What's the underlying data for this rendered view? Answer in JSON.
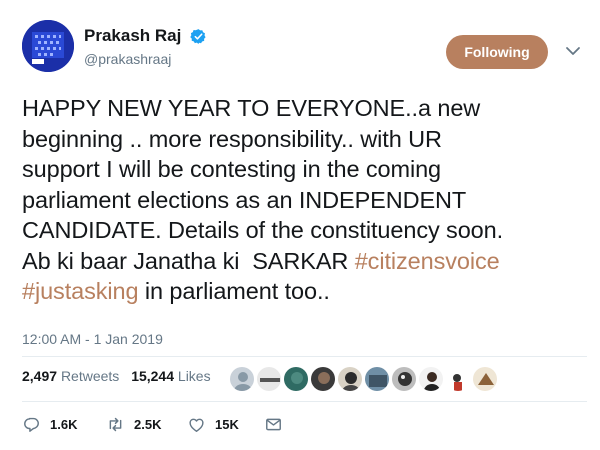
{
  "user": {
    "display_name": "Prakash Raj",
    "handle": "@prakashraaj"
  },
  "follow_button_label": "Following",
  "tweet": {
    "lines": [
      "HAPPY NEW YEAR TO EVERYONE..a new",
      "beginning .. more responsibility.. with UR",
      "support I will be contesting in the coming",
      "parliament elections as an INDEPENDENT",
      "CANDIDATE. Details of the constituency soon."
    ],
    "line6_text": "Ab ki baar Janatha ki  SARKAR ",
    "hashtag1": "#citizensvoice",
    "hashtag2": "#justasking",
    "line7_text": " in parliament too.."
  },
  "timestamp": "12:00 AM - 1 Jan 2019",
  "stats": {
    "retweets_count": "2,497",
    "retweets_label": "Retweets",
    "likes_count": "15,244",
    "likes_label": "Likes"
  },
  "likers": [
    "avatar-1",
    "avatar-2",
    "avatar-3",
    "avatar-4",
    "avatar-5",
    "avatar-6",
    "avatar-7",
    "avatar-8",
    "avatar-9",
    "avatar-10"
  ],
  "actions": {
    "reply_count": "1.6K",
    "retweet_count": "2.5K",
    "like_count": "15K"
  },
  "colors": {
    "accent": "#b8805f",
    "secondary_text": "#657786",
    "verified": "#1da1f2",
    "avatar_bg": "#1b2fa8"
  },
  "icons": {
    "verified": "verified-badge-icon",
    "chevron": "chevron-down-icon",
    "reply": "reply-icon",
    "retweet": "retweet-icon",
    "like": "heart-icon",
    "dm": "envelope-icon"
  }
}
